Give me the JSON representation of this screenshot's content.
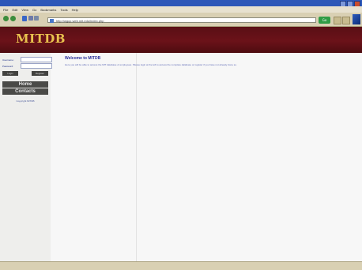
{
  "browser": {
    "menu": [
      "File",
      "Edit",
      "View",
      "Go",
      "Bookmarks",
      "Tools",
      "Help"
    ],
    "address": "http://wgcp.web.mit.edu/index.php",
    "go_label": "Go"
  },
  "site": {
    "title": "MITDB"
  },
  "login": {
    "username_label": "Username:",
    "password_label": "Password:",
    "login_button": "Login",
    "register_button": "Register"
  },
  "sidebar": {
    "items": [
      {
        "label": "Home"
      },
      {
        "label": "Contacts"
      }
    ],
    "copyright": "Copyright MITDB"
  },
  "content": {
    "heading": "Welcome to MITDB",
    "body": "Here you will be able to access the MIT database of employees. Please login at the left to access the complete database or register if you have not already done so."
  }
}
